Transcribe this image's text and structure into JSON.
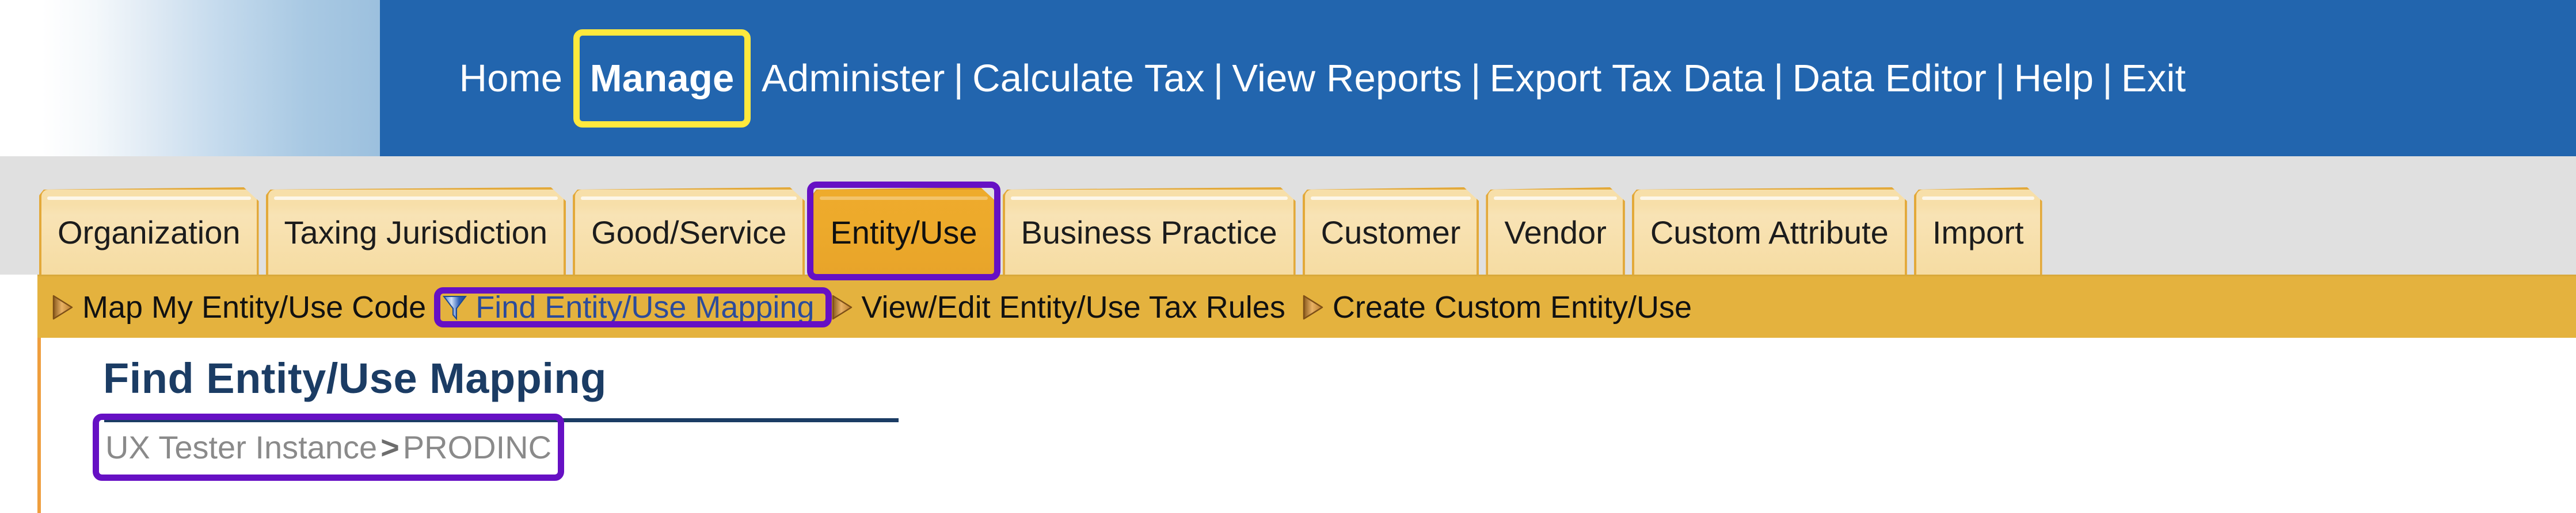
{
  "header": {
    "nav_items": [
      {
        "label": "Home",
        "active": false
      },
      {
        "label": "Manage",
        "active": true
      },
      {
        "label": "Administer",
        "active": false
      },
      {
        "label": "Calculate Tax",
        "active": false
      },
      {
        "label": "View Reports",
        "active": false
      },
      {
        "label": "Export Tax Data",
        "active": false
      },
      {
        "label": "Data Editor",
        "active": false
      },
      {
        "label": "Help",
        "active": false
      },
      {
        "label": "Exit",
        "active": false
      }
    ],
    "separator": "|",
    "background_color": "#2265ae"
  },
  "tabs": [
    {
      "label": "Organization",
      "active": false
    },
    {
      "label": "Taxing Jurisdiction",
      "active": false
    },
    {
      "label": "Good/Service",
      "active": false
    },
    {
      "label": "Entity/Use",
      "active": true
    },
    {
      "label": "Business Practice",
      "active": false
    },
    {
      "label": "Customer",
      "active": false
    },
    {
      "label": "Vendor",
      "active": false
    },
    {
      "label": "Custom Attribute",
      "active": false
    },
    {
      "label": "Import",
      "active": false
    }
  ],
  "subnav": [
    {
      "label": "Map My Entity/Use Code",
      "icon": "play-triangle-icon",
      "current": false
    },
    {
      "label": "Find Entity/Use Mapping",
      "icon": "funnel-filter-icon",
      "current": true
    },
    {
      "label": "View/Edit Entity/Use Tax Rules",
      "icon": "play-triangle-icon",
      "current": false
    },
    {
      "label": "Create Custom Entity/Use",
      "icon": "play-triangle-icon",
      "current": false
    }
  ],
  "main": {
    "page_title": "Find Entity/Use Mapping",
    "breadcrumb": {
      "root": "UX Tester Instance",
      "separator": ">",
      "current": "PRODINC"
    }
  },
  "annotations": {
    "highlight_yellow_color": "#ffe93d",
    "highlight_purple_color": "#6610c4",
    "yellow_targets": [
      "Manage"
    ],
    "purple_targets": [
      "Entity/Use tab",
      "Find Entity/Use Mapping subnav item",
      "breadcrumb"
    ]
  },
  "colors": {
    "header_blue": "#2265ae",
    "tab_orange": "#e4b23e",
    "tab_active_orange": "#eeab2c",
    "title_navy": "#1b3c64",
    "subnav_link_blue": "#2c4b9b",
    "content_left_border": "#ef9e3d",
    "tabstrip_gray": "#e0e0e0"
  }
}
